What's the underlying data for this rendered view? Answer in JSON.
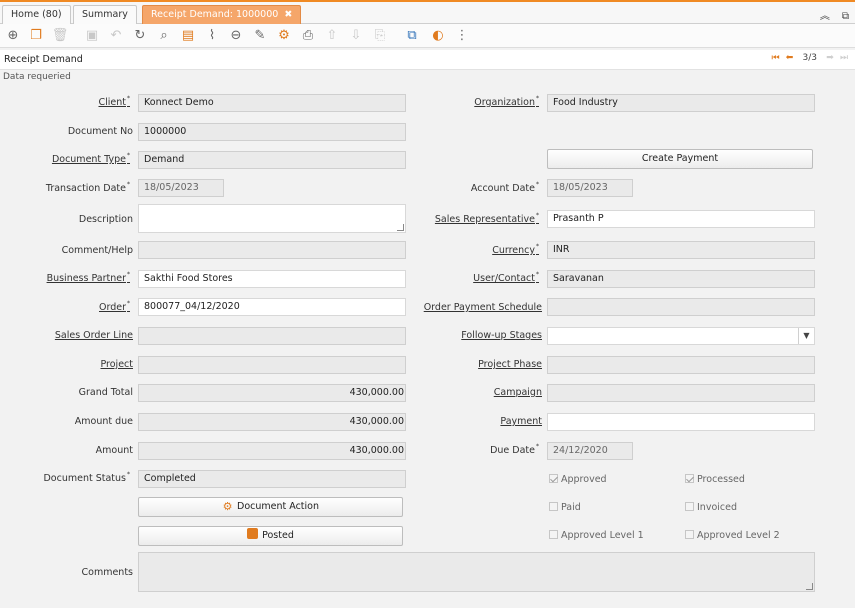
{
  "tabs": [
    {
      "label": "Home (80)"
    },
    {
      "label": "Summary"
    },
    {
      "label": "Receipt Demand: 1000000",
      "close": "✖"
    }
  ],
  "tabbar_icons": {
    "collapse": "︽",
    "external": "⧉"
  },
  "window": {
    "title": "Receipt Demand",
    "record_nav": "3/3",
    "status_message": "Data requeried"
  },
  "toolbar_icons": [
    "new-record-icon",
    "copy-record-icon",
    "delete-icon",
    "save-icon",
    "undo-icon",
    "refresh-icon",
    "find-icon",
    "history-icon",
    "attachment-icon",
    "zoom-icon",
    "notes-icon",
    "process-icon",
    "print-icon",
    "parent-icon",
    "detail-icon",
    "report-icon",
    "workflow-icon",
    "actions-icon",
    "more-icon"
  ],
  "form": {
    "client": {
      "label": "Client",
      "value": "Konnect Demo"
    },
    "organization": {
      "label": "Organization",
      "value": "Food Industry"
    },
    "document_no": {
      "label": "Document No",
      "value": "1000000"
    },
    "document_type": {
      "label": "Document Type",
      "value": "Demand"
    },
    "create_payment": "Create Payment",
    "transaction_date": {
      "label": "Transaction Date",
      "value": "18/05/2023"
    },
    "account_date": {
      "label": "Account Date",
      "value": "18/05/2023"
    },
    "description": {
      "label": "Description",
      "value": ""
    },
    "sales_rep": {
      "label": "Sales Representative",
      "value": "Prasanth P"
    },
    "comment_help": {
      "label": "Comment/Help",
      "value": ""
    },
    "currency": {
      "label": "Currency",
      "value": "INR"
    },
    "business_partner": {
      "label": "Business Partner",
      "value": "Sakthi Food Stores"
    },
    "user_contact": {
      "label": "User/Contact",
      "value": "Saravanan"
    },
    "order": {
      "label": "Order",
      "value": "800077_04/12/2020"
    },
    "order_payment_schedule": {
      "label": "Order Payment Schedule",
      "value": ""
    },
    "sales_order_line": {
      "label": "Sales Order Line",
      "value": ""
    },
    "followup_stages": {
      "label": "Follow-up Stages",
      "value": ""
    },
    "project": {
      "label": "Project",
      "value": ""
    },
    "project_phase": {
      "label": "Project Phase",
      "value": ""
    },
    "grand_total": {
      "label": "Grand Total",
      "value": "430,000.00"
    },
    "campaign": {
      "label": "Campaign",
      "value": ""
    },
    "amount_due": {
      "label": "Amount due",
      "value": "430,000.00"
    },
    "payment": {
      "label": "Payment",
      "value": ""
    },
    "amount": {
      "label": "Amount",
      "value": "430,000.00"
    },
    "due_date": {
      "label": "Due Date",
      "value": "24/12/2020"
    },
    "document_status": {
      "label": "Document Status",
      "value": "Completed"
    },
    "document_action": "Document Action",
    "posted": "Posted",
    "comments": {
      "label": "Comments",
      "value": ""
    },
    "checkboxes": {
      "approved": {
        "label": "Approved",
        "checked": true
      },
      "processed": {
        "label": "Processed",
        "checked": true
      },
      "paid": {
        "label": "Paid",
        "checked": false
      },
      "invoiced": {
        "label": "Invoiced",
        "checked": false
      },
      "approved_level_1": {
        "label": "Approved Level 1",
        "checked": false
      },
      "approved_level_2": {
        "label": "Approved Level 2",
        "checked": false
      }
    }
  },
  "colors": {
    "accent": "#f08a24",
    "active_tab": "#f5a66a"
  }
}
